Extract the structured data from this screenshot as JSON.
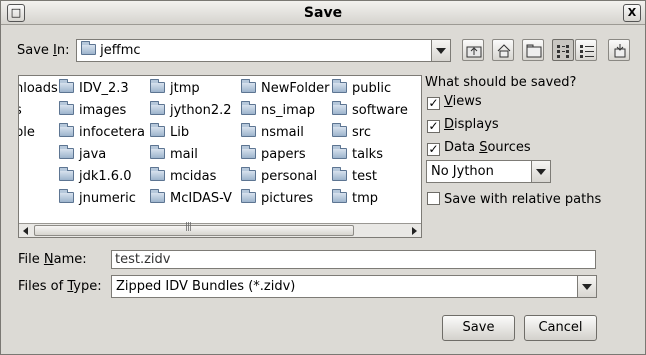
{
  "window": {
    "title": "Save",
    "close_glyph": "X"
  },
  "save_in": {
    "label_pre": "Save ",
    "label_key": "I",
    "label_post": "n:",
    "value": "jeffmc"
  },
  "toolbar": {
    "icons": [
      "up-one-level-icon",
      "home-icon",
      "new-folder-icon",
      "list-view-icon",
      "details-view-icon",
      "extra-icon"
    ]
  },
  "files": {
    "columns": [
      [
        "nloads",
        "s",
        "ple"
      ],
      [
        "IDV_2.3",
        "images",
        "infocetera",
        "java",
        "jdk1.6.0",
        "jnumeric"
      ],
      [
        "jtmp",
        "jython2.2",
        "Lib",
        "mail",
        "mcidas",
        "McIDAS-V"
      ],
      [
        "NewFolder",
        "ns_imap",
        "nsmail",
        "papers",
        "personal",
        "pictures"
      ],
      [
        "public",
        "software",
        "src",
        "talks",
        "test",
        "tmp"
      ]
    ]
  },
  "options": {
    "heading": "What should be saved?",
    "views": {
      "label_key": "V",
      "label_rest": "iews",
      "checked": true
    },
    "displays": {
      "label_key": "D",
      "label_rest": "isplays",
      "checked": true
    },
    "data_sources": {
      "label_pre": "Data ",
      "label_key": "S",
      "label_rest": "ources",
      "checked": true
    },
    "jython_select": "No Jython",
    "relative_paths": {
      "label": "Save with relative paths",
      "checked": false
    }
  },
  "file_name": {
    "label_pre": "File ",
    "label_key": "N",
    "label_post": "ame:",
    "value": "test.zidv"
  },
  "file_type": {
    "label_pre": "Files of ",
    "label_key": "T",
    "label_post": "ype:",
    "value": "Zipped IDV Bundles (*.zidv)"
  },
  "buttons": {
    "save": "Save",
    "cancel": "Cancel"
  }
}
